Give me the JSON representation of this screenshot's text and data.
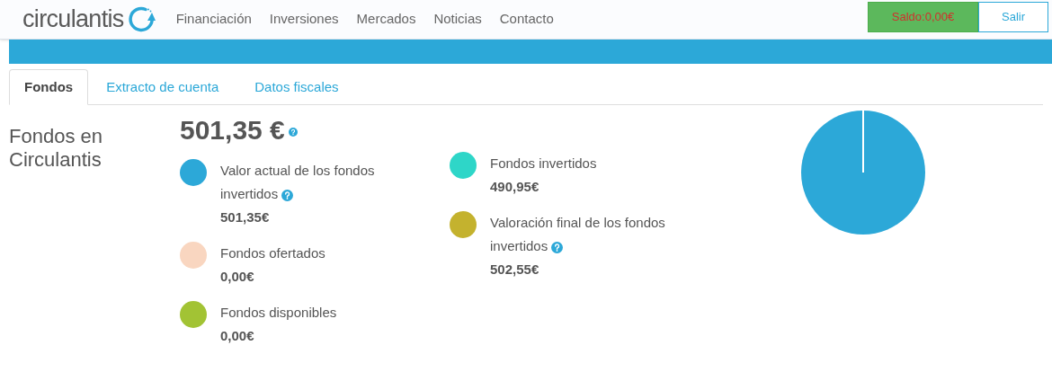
{
  "header": {
    "logo": "circulantis",
    "nav": [
      "Financiación",
      "Inversiones",
      "Mercados",
      "Noticias",
      "Contacto"
    ],
    "balance_button": "Saldo:0,00€",
    "logout_button": "Salir"
  },
  "tabs": [
    {
      "label": "Fondos",
      "selected": true
    },
    {
      "label": "Extracto de cuenta",
      "selected": false
    },
    {
      "label": "Datos fiscales",
      "selected": false
    }
  ],
  "section_title": "Fondos en Circulantis",
  "total": {
    "amount": "501,35 €",
    "help": true
  },
  "legend_columns": [
    [
      {
        "label": "Valor actual de los fondos invertidos",
        "help": true,
        "value": "501,35€",
        "color": "#2ca8d8"
      },
      {
        "label": "Fondos ofertados",
        "help": false,
        "value": "0,00€",
        "color": "#f9d6c0"
      },
      {
        "label": "Fondos disponibles",
        "help": false,
        "value": "0,00€",
        "color": "#a2c334"
      }
    ],
    [
      {
        "label": "Fondos invertidos",
        "help": false,
        "value": "490,95€",
        "color": "#2ed6c8"
      },
      {
        "label": "Valoración final de los fondos invertidos",
        "help": true,
        "value": "502,55€",
        "color": "#c4b22e"
      }
    ]
  ]
}
